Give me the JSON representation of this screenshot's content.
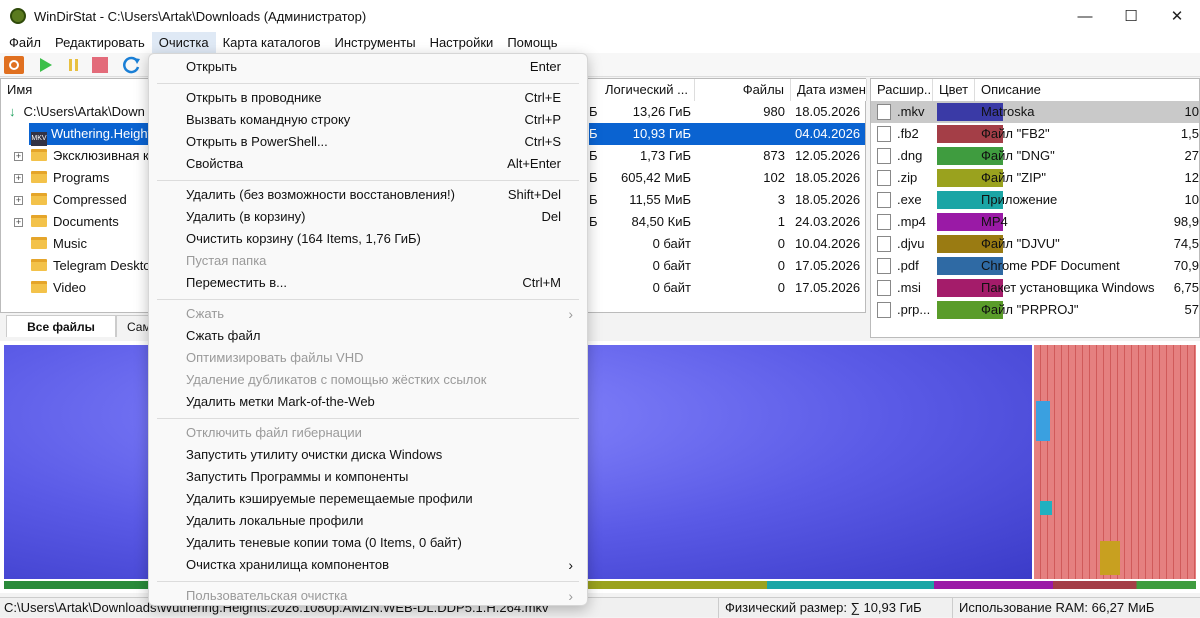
{
  "window": {
    "title": "WinDirStat - C:\\Users\\Artak\\Downloads  (Администратор)",
    "controls": [
      "—",
      "☐",
      "✕"
    ]
  },
  "menubar": [
    "Файл",
    "Редактировать",
    "Очистка",
    "Карта каталогов",
    "Инструменты",
    "Настройки",
    "Помощь"
  ],
  "tree": {
    "header": "Имя",
    "root": "C:\\Users\\Artak\\Down",
    "items": [
      {
        "label": "Wuthering.Heights",
        "selected": true
      },
      {
        "label": "Эксклюзивная к"
      },
      {
        "label": "Programs"
      },
      {
        "label": "Compressed"
      },
      {
        "label": "Documents"
      },
      {
        "label": "Music"
      },
      {
        "label": "Telegram Desktop"
      },
      {
        "label": "Video"
      }
    ]
  },
  "list": {
    "headers": {
      "logical": "Логический ...",
      "files": "Файлы",
      "date": "Дата измене"
    },
    "rows": [
      {
        "prefix": "Б",
        "logical": "13,26 ГиБ",
        "files": "980",
        "date": "18.05.2026"
      },
      {
        "prefix": "Б",
        "logical": "10,93 ГиБ",
        "files": "",
        "date": "04.04.2026",
        "selected": true
      },
      {
        "prefix": "Б",
        "logical": "1,73 ГиБ",
        "files": "873",
        "date": "12.05.2026"
      },
      {
        "prefix": "Б",
        "logical": "605,42 МиБ",
        "files": "102",
        "date": "18.05.2026"
      },
      {
        "prefix": "Б",
        "logical": "11,55 МиБ",
        "files": "3",
        "date": "18.05.2026"
      },
      {
        "prefix": "Б",
        "logical": "84,50 КиБ",
        "files": "1",
        "date": "24.03.2026"
      },
      {
        "prefix": "",
        "logical": "0 байт",
        "files": "0",
        "date": "10.04.2026"
      },
      {
        "prefix": "",
        "logical": "0 байт",
        "files": "0",
        "date": "17.05.2026"
      },
      {
        "prefix": "",
        "logical": "0 байт",
        "files": "0",
        "date": "17.05.2026"
      }
    ]
  },
  "tabs": {
    "all_files": "Все файлы",
    "second": "Сам"
  },
  "extensions": {
    "headers": {
      "ext": "Расшир...",
      "color": "Цвет",
      "desc": "Описание"
    },
    "rows": [
      {
        "ext": ".mkv",
        "color": "#3a3aa6",
        "desc": "Matroska",
        "num": "10",
        "selected": true
      },
      {
        "ext": ".fb2",
        "color": "#a43e47",
        "desc": "Файл \"FB2\"",
        "num": "1,5"
      },
      {
        "ext": ".dng",
        "color": "#3f9c3f",
        "desc": "Файл \"DNG\"",
        "num": "27"
      },
      {
        "ext": ".zip",
        "color": "#9aa21e",
        "desc": "Файл \"ZIP\"",
        "num": "12"
      },
      {
        "ext": ".exe",
        "color": "#1ba5a5",
        "desc": "Приложение",
        "num": "10"
      },
      {
        "ext": ".mp4",
        "color": "#9a1aa6",
        "desc": "MP4",
        "num": "98,9"
      },
      {
        "ext": ".djvu",
        "color": "#9a7b12",
        "desc": "Файл \"DJVU\"",
        "num": "74,5"
      },
      {
        "ext": ".pdf",
        "color": "#2f6aa4",
        "desc": "Chrome PDF Document",
        "num": "70,9"
      },
      {
        "ext": ".msi",
        "color": "#a41c6a",
        "desc": "Пакет установщика Windows",
        "num": "6,75"
      },
      {
        "ext": ".prp...",
        "color": "#5a9c2a",
        "desc": "Файл \"PRPROJ\"",
        "num": "57"
      }
    ]
  },
  "context_menu": {
    "items": [
      {
        "label": "Открыть",
        "shortcut": "Enter"
      },
      {
        "sep": true
      },
      {
        "label": "Открыть в проводнике",
        "shortcut": "Ctrl+E"
      },
      {
        "label": "Вызвать командную строку",
        "shortcut": "Ctrl+P"
      },
      {
        "label": "Открыть в PowerShell...",
        "shortcut": "Ctrl+S"
      },
      {
        "label": "Свойства",
        "shortcut": "Alt+Enter"
      },
      {
        "sep": true
      },
      {
        "label": "Удалить (без возможности восстановления!)",
        "shortcut": "Shift+Del"
      },
      {
        "label": "Удалить (в корзину)",
        "shortcut": "Del"
      },
      {
        "label": "Очистить корзину (164 Items, 1,76 ГиБ)",
        "shortcut": ""
      },
      {
        "label": "Пустая папка",
        "shortcut": "",
        "disabled": true
      },
      {
        "label": "Переместить в...",
        "shortcut": "Ctrl+M"
      },
      {
        "sep": true
      },
      {
        "label": "Сжать",
        "shortcut": "",
        "disabled": true,
        "submenu": true
      },
      {
        "label": "Сжать файл",
        "shortcut": ""
      },
      {
        "label": "Оптимизировать файлы VHD",
        "shortcut": "",
        "disabled": true
      },
      {
        "label": "Удаление дубликатов с помощью жёстких ссылок",
        "shortcut": "",
        "disabled": true
      },
      {
        "label": "Удалить метки Mark-of-the-Web",
        "shortcut": ""
      },
      {
        "sep": true
      },
      {
        "label": "Отключить файл гибернации",
        "shortcut": "",
        "disabled": true
      },
      {
        "label": "Запустить утилиту очистки диска Windows",
        "shortcut": ""
      },
      {
        "label": "Запустить Программы и компоненты",
        "shortcut": ""
      },
      {
        "label": "Удалить кэшируемые перемещаемые профили",
        "shortcut": ""
      },
      {
        "label": "Удалить локальные профили",
        "shortcut": ""
      },
      {
        "label": "Удалить теневые копии тома (0 Items, 0 байт)",
        "shortcut": ""
      },
      {
        "label": "Очистка хранилища компонентов",
        "shortcut": "",
        "submenu": true
      },
      {
        "sep": true
      },
      {
        "label": "Пользовательская очистка",
        "shortcut": "",
        "disabled": true,
        "submenu": true
      }
    ]
  },
  "status": {
    "path": "C:\\Users\\Artak\\Downloads\\Wuthering.Heights.2026.1080p.AMZN.WEB-DL.DDP5.1.H.264.mkv",
    "physical": "Физический размер: ∑ 10,93 ГиБ",
    "ram": "Использование RAM: 66,27 МиБ"
  },
  "colors": {
    "accent": "#0a63d1",
    "treemap_main": "#5555e0"
  }
}
